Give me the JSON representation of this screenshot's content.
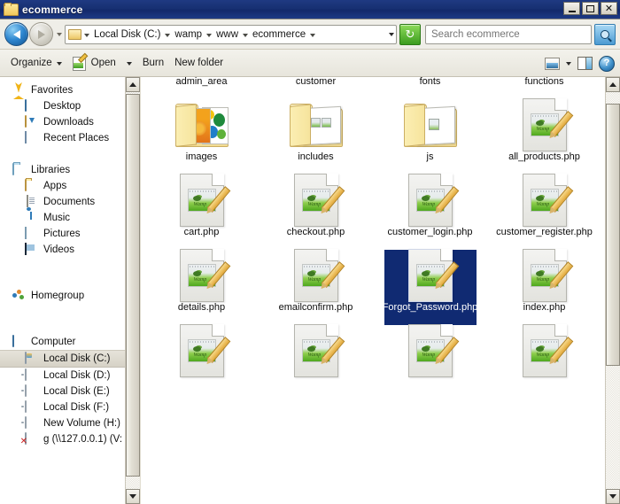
{
  "window": {
    "title": "ecommerce",
    "controls": {
      "minimize": "–",
      "maximize": "□",
      "close": "✕"
    }
  },
  "address_bar": {
    "back_label": "Back",
    "forward_label": "Forward",
    "recent_dropdown_label": "Recent pages",
    "breadcrumbs": [
      "Local Disk (C:)",
      "wamp",
      "www",
      "ecommerce"
    ],
    "refresh_label": "↻",
    "path_dropdown_label": "Previous locations"
  },
  "search": {
    "placeholder": "Search ecommerce",
    "value": "",
    "button_label": "Search"
  },
  "command_bar": {
    "organize": "Organize",
    "open": "Open",
    "burn": "Burn",
    "new_folder": "New folder",
    "change_view_label": "Change your view",
    "view_dropdown_label": "More options",
    "preview_pane_label": "Show the preview pane",
    "help_label": "?"
  },
  "nav_pane": {
    "groups": [
      {
        "header": {
          "label": "Favorites",
          "icon": "star-icon"
        },
        "items": [
          {
            "label": "Desktop",
            "icon": "desktop-icon"
          },
          {
            "label": "Downloads",
            "icon": "downloads-icon"
          },
          {
            "label": "Recent Places",
            "icon": "recent-places-icon"
          }
        ]
      },
      {
        "header": {
          "label": "Libraries",
          "icon": "libraries-icon"
        },
        "items": [
          {
            "label": "Apps",
            "icon": "folder-icon"
          },
          {
            "label": "Documents",
            "icon": "document-icon"
          },
          {
            "label": "Music",
            "icon": "music-icon"
          },
          {
            "label": "Pictures",
            "icon": "picture-icon"
          },
          {
            "label": "Videos",
            "icon": "video-icon"
          }
        ]
      },
      {
        "header": {
          "label": "Homegroup",
          "icon": "homegroup-icon"
        },
        "items": []
      },
      {
        "header": {
          "label": "Computer",
          "icon": "computer-icon"
        },
        "items": [
          {
            "label": "Local Disk (C:)",
            "icon": "system-drive-icon",
            "selected": true
          },
          {
            "label": "Local Disk (D:)",
            "icon": "drive-icon"
          },
          {
            "label": "Local Disk (E:)",
            "icon": "drive-icon"
          },
          {
            "label": "Local Disk (F:)",
            "icon": "drive-icon"
          },
          {
            "label": "New Volume (H:)",
            "icon": "drive-icon"
          },
          {
            "label": "g (\\\\127.0.0.1) (V:",
            "icon": "disconnected-network-drive-icon"
          }
        ]
      }
    ]
  },
  "file_list": {
    "items": [
      {
        "name": "admin_area",
        "type": "folder",
        "selected": false
      },
      {
        "name": "customer",
        "type": "folder-files",
        "selected": false
      },
      {
        "name": "fonts",
        "type": "folder",
        "selected": false
      },
      {
        "name": "functions",
        "type": "folder-php",
        "selected": false
      },
      {
        "name": "images",
        "type": "folder-images",
        "selected": false
      },
      {
        "name": "includes",
        "type": "folder-files",
        "selected": false
      },
      {
        "name": "js",
        "type": "folder-js",
        "selected": false
      },
      {
        "name": "all_products.php",
        "type": "php",
        "selected": false
      },
      {
        "name": "cart.php",
        "type": "php",
        "selected": false
      },
      {
        "name": "checkout.php",
        "type": "php",
        "selected": false
      },
      {
        "name": "customer_login.php",
        "type": "php",
        "selected": false
      },
      {
        "name": "customer_register.php",
        "type": "php",
        "selected": false
      },
      {
        "name": "details.php",
        "type": "php",
        "selected": false
      },
      {
        "name": "emailconfirm.php",
        "type": "php",
        "selected": false
      },
      {
        "name": "Forgot_Password.php",
        "type": "php",
        "selected": true
      },
      {
        "name": "index.php",
        "type": "php",
        "selected": false
      },
      {
        "name": "",
        "type": "php",
        "selected": false
      },
      {
        "name": "",
        "type": "php",
        "selected": false
      },
      {
        "name": "",
        "type": "php",
        "selected": false
      },
      {
        "name": "",
        "type": "php",
        "selected": false
      }
    ],
    "wamp_icon_text": "Wamp"
  },
  "scrollbars": {
    "nav_pane": {
      "up_label": "Scroll up",
      "down_label": "Scroll down"
    },
    "file_pane": {
      "up_label": "Scroll up",
      "down_label": "Scroll down"
    }
  },
  "colors": {
    "title_bar": "#16306f",
    "selection": "#102a72",
    "nav_selection": "#ddd9cd",
    "chrome": "#efeee8",
    "refresh_green": "#3b9c1f"
  }
}
